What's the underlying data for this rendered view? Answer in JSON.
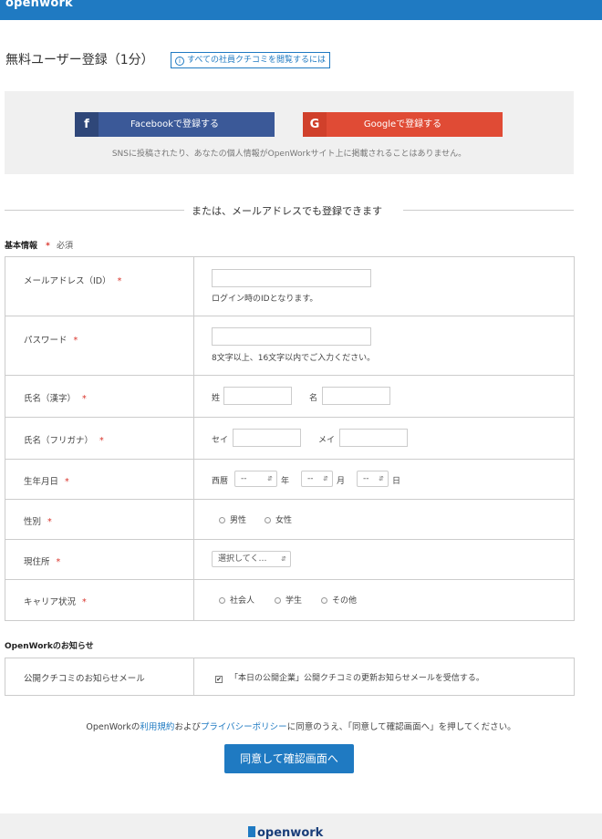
{
  "header": {
    "logo": "openwork"
  },
  "registration": {
    "title": "無料ユーザー登録（1分）",
    "info_icon": "i",
    "info_link": "すべての社員クチコミを閲覧するには"
  },
  "sns": {
    "facebook_icon": "f",
    "facebook_label": "Facebookで登録する",
    "google_icon": "G",
    "google_label": "Googleで登録する",
    "note": "SNSに投稿されたり、あなたの個人情報がOpenWorkサイト上に掲載されることはありません。"
  },
  "divider_text": "または、メールアドレスでも登録できます",
  "basic_info": {
    "heading": "基本情報",
    "required_mark": "*",
    "required_note": "必須",
    "email": {
      "label": "メールアドレス（ID）",
      "value": "",
      "hint": "ログイン時のIDとなります。"
    },
    "password": {
      "label": "パスワード",
      "value": "",
      "hint": "8文字以上、16文字以内でご入力ください。"
    },
    "name_kanji": {
      "label": "氏名（漢字）",
      "last_label": "姓",
      "first_label": "名",
      "last_value": "",
      "first_value": ""
    },
    "name_kana": {
      "label": "氏名（フリガナ）",
      "last_label": "セイ",
      "first_label": "メイ",
      "last_value": "",
      "first_value": ""
    },
    "birthday": {
      "label": "生年月日",
      "era_label": "西暦",
      "year_value": "--",
      "year_unit": "年",
      "month_value": "--",
      "month_unit": "月",
      "day_value": "--",
      "day_unit": "日"
    },
    "gender": {
      "label": "性別",
      "options": [
        "男性",
        "女性"
      ]
    },
    "residence": {
      "label": "現住所",
      "selected": "選択してく…"
    },
    "career": {
      "label": "キャリア状況",
      "options": [
        "社会人",
        "学生",
        "その他"
      ]
    }
  },
  "notices": {
    "heading": "OpenWorkのお知らせ",
    "label": "公開クチコミのお知らせメール",
    "checked_mark": "✔",
    "checkbox_text": "「本日の公開企業」公開クチコミの更新お知らせメールを受信する。"
  },
  "agreement": {
    "prefix": "OpenWorkの",
    "terms_link": "利用規約",
    "and": "および",
    "privacy_link": "プライバシーポリシー",
    "suffix": "に同意のうえ、「同意して確認画面へ」を押してください。"
  },
  "submit_label": "同意して確認画面へ",
  "footer": {
    "logo": "openwork"
  },
  "colors": {
    "brand": "#1f7ac2",
    "facebook": "#3b5998",
    "google": "#e04b35",
    "required": "#d9342b"
  },
  "icons": {
    "facebook": "facebook-icon",
    "google": "google-icon",
    "info": "info-icon",
    "dropdown": "chevron-down-icon"
  }
}
